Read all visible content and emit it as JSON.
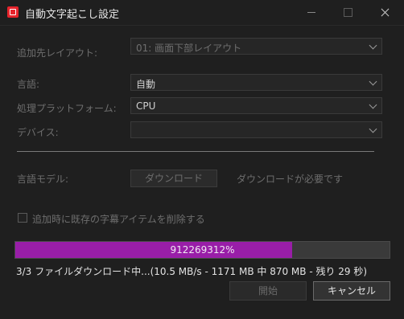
{
  "window": {
    "title": "自動文字起こし設定",
    "icon": "app-logo-icon"
  },
  "form": {
    "destination_layout": {
      "label": "追加先レイアウト:",
      "value": "01: 画面下部レイアウト"
    },
    "language": {
      "label": "言語:",
      "value": "自動"
    },
    "platform": {
      "label": "処理プラットフォーム:",
      "value": "CPU"
    },
    "device": {
      "label": "デバイス:",
      "value": ""
    },
    "language_model": {
      "label": "言語モデル:",
      "download_button": "ダウンロード",
      "note": "ダウンロードが必要です"
    },
    "delete_existing": {
      "label": "追加時に既存の字幕アイテムを削除する",
      "checked": false
    }
  },
  "progress": {
    "text": "912269312%",
    "fill_fraction": 0.74,
    "fill_color": "#991ea8"
  },
  "status": {
    "text": "3/3 ファイルダウンロード中...(10.5 MB/s - 1171 MB 中 870 MB - 残り 29 秒)"
  },
  "buttons": {
    "start": "開始",
    "cancel": "キャンセル"
  }
}
